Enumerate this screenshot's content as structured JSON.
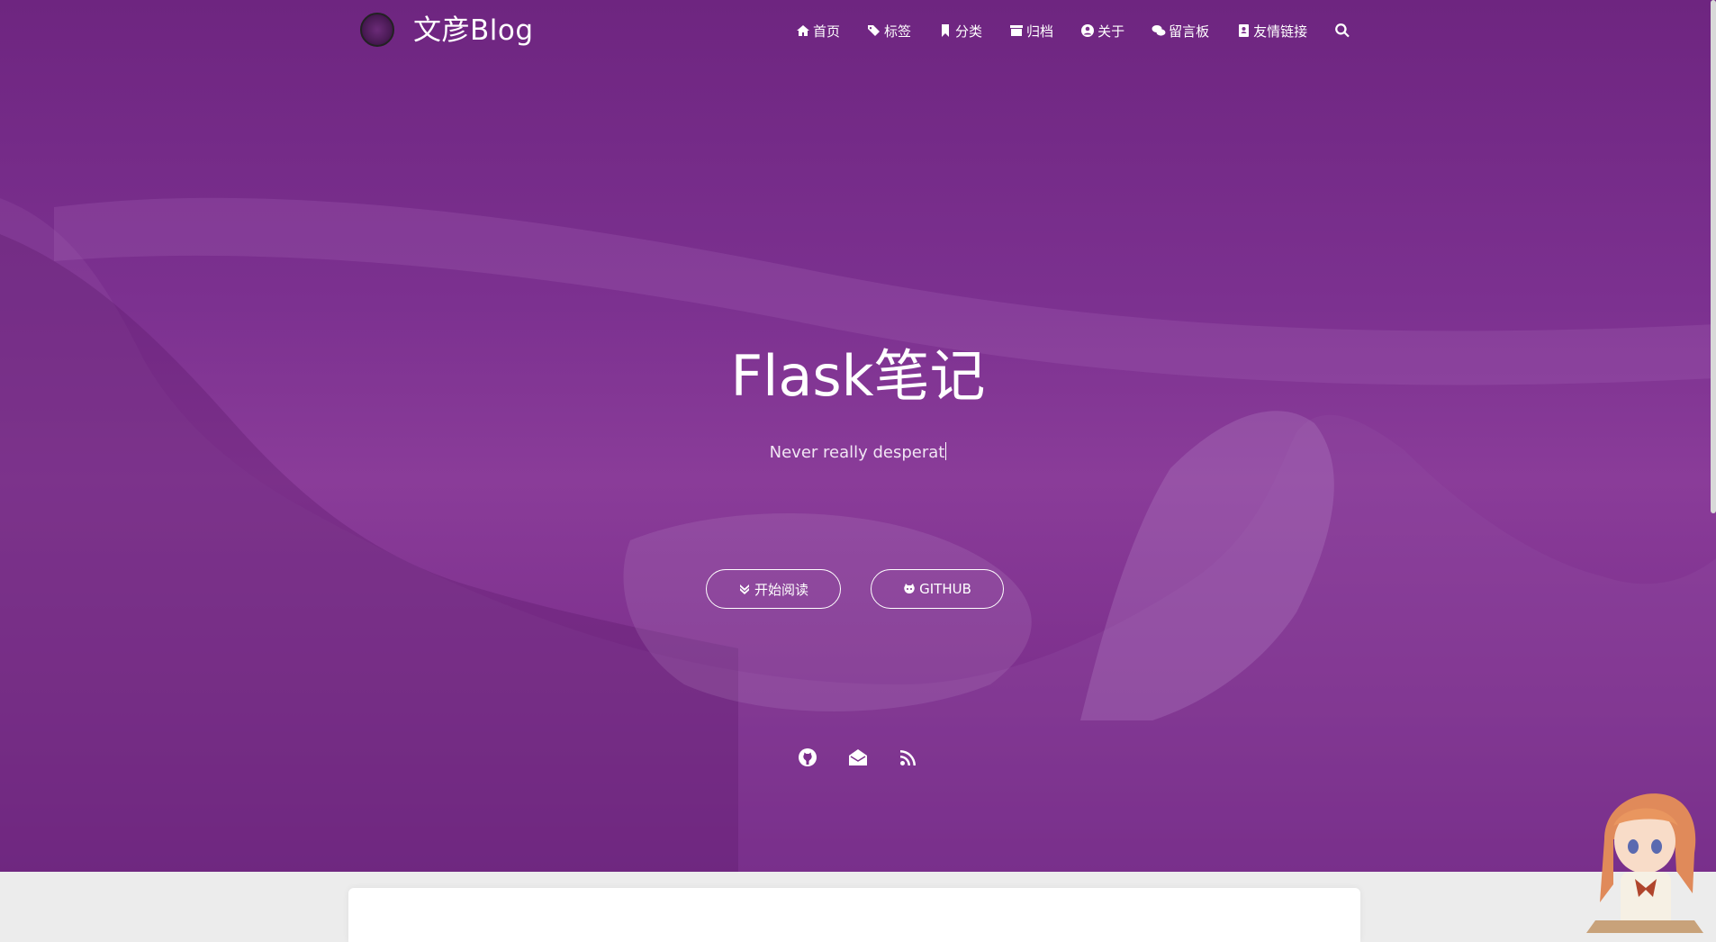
{
  "brand": {
    "name": "文彦Blog"
  },
  "nav": {
    "items": [
      {
        "label": "首页",
        "icon": "home-icon"
      },
      {
        "label": "标签",
        "icon": "tags-icon"
      },
      {
        "label": "分类",
        "icon": "bookmark-icon"
      },
      {
        "label": "归档",
        "icon": "archive-icon"
      },
      {
        "label": "关于",
        "icon": "user-circle-icon"
      },
      {
        "label": "留言板",
        "icon": "comments-icon"
      },
      {
        "label": "友情链接",
        "icon": "address-book-icon"
      }
    ],
    "search_icon": "search-icon"
  },
  "hero": {
    "title": "Flask笔记",
    "subtitle": "Never really desperat",
    "buttons": {
      "read_label": "开始阅读",
      "read_icon": "double-chevron-down-icon",
      "github_label": "GITHUB",
      "github_icon": "octocat-icon"
    },
    "social_icons": [
      "github-icon",
      "envelope-open-icon",
      "rss-icon"
    ]
  },
  "colors": {
    "hero_purple": "#7c2f8c",
    "page_bg": "#ececec",
    "text": "#ffffff"
  }
}
